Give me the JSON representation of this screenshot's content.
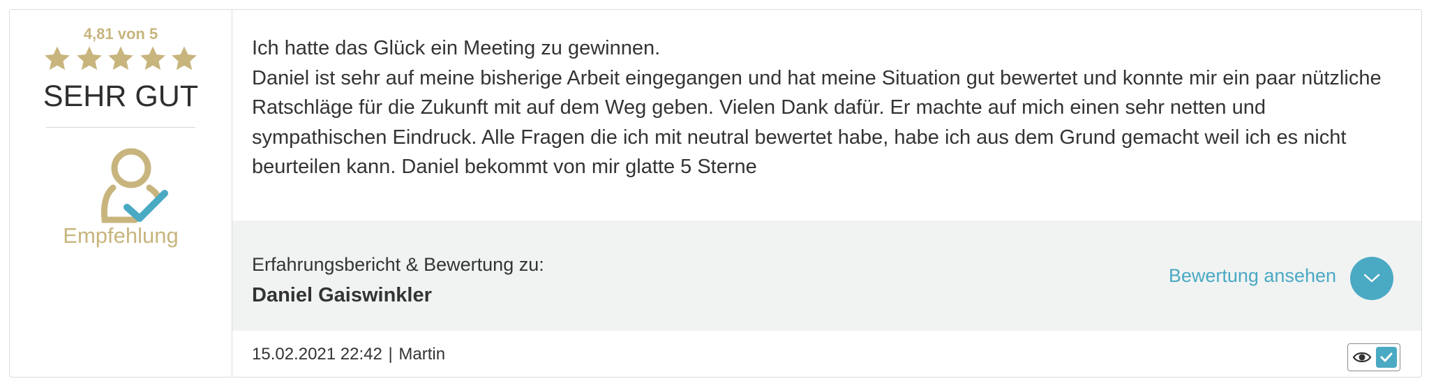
{
  "rating": {
    "score_text": "4,81 von 5",
    "stars": 5,
    "grade": "SEHR GUT",
    "recommendation_label": "Empfehlung"
  },
  "review": {
    "line1": "Ich hatte das Glück ein Meeting zu gewinnen.",
    "line2": "Daniel ist sehr auf meine bisherige Arbeit eingegangen und hat meine Situation gut bewertet und konnte mir ein paar nützliche Ratschläge für die Zukunft mit auf dem Weg geben. Vielen Dank dafür. Er machte auf mich einen sehr netten und sympathischen Eindruck. Alle Fragen die ich mit neutral bewertet habe, habe ich aus dem Grund gemacht weil ich es nicht beurteilen kann. Daniel bekommt von mir glatte 5 Sterne"
  },
  "subject": {
    "label": "Erfahrungsbericht & Bewertung zu:",
    "name": "Daniel Gaiswinkler",
    "view_link": "Bewertung ansehen"
  },
  "footer": {
    "date": "15.02.2021 22:42",
    "separator": "|",
    "author": "Martin"
  },
  "colors": {
    "gold": "#c8b57e",
    "accent_blue": "#4aa9c3",
    "panel_bg": "#f1f3f3"
  },
  "icons": {
    "star": "star-icon",
    "recommend": "user-check-icon",
    "expand": "chevron-down-icon",
    "view": "eye-icon",
    "verified": "checkmark-icon"
  }
}
